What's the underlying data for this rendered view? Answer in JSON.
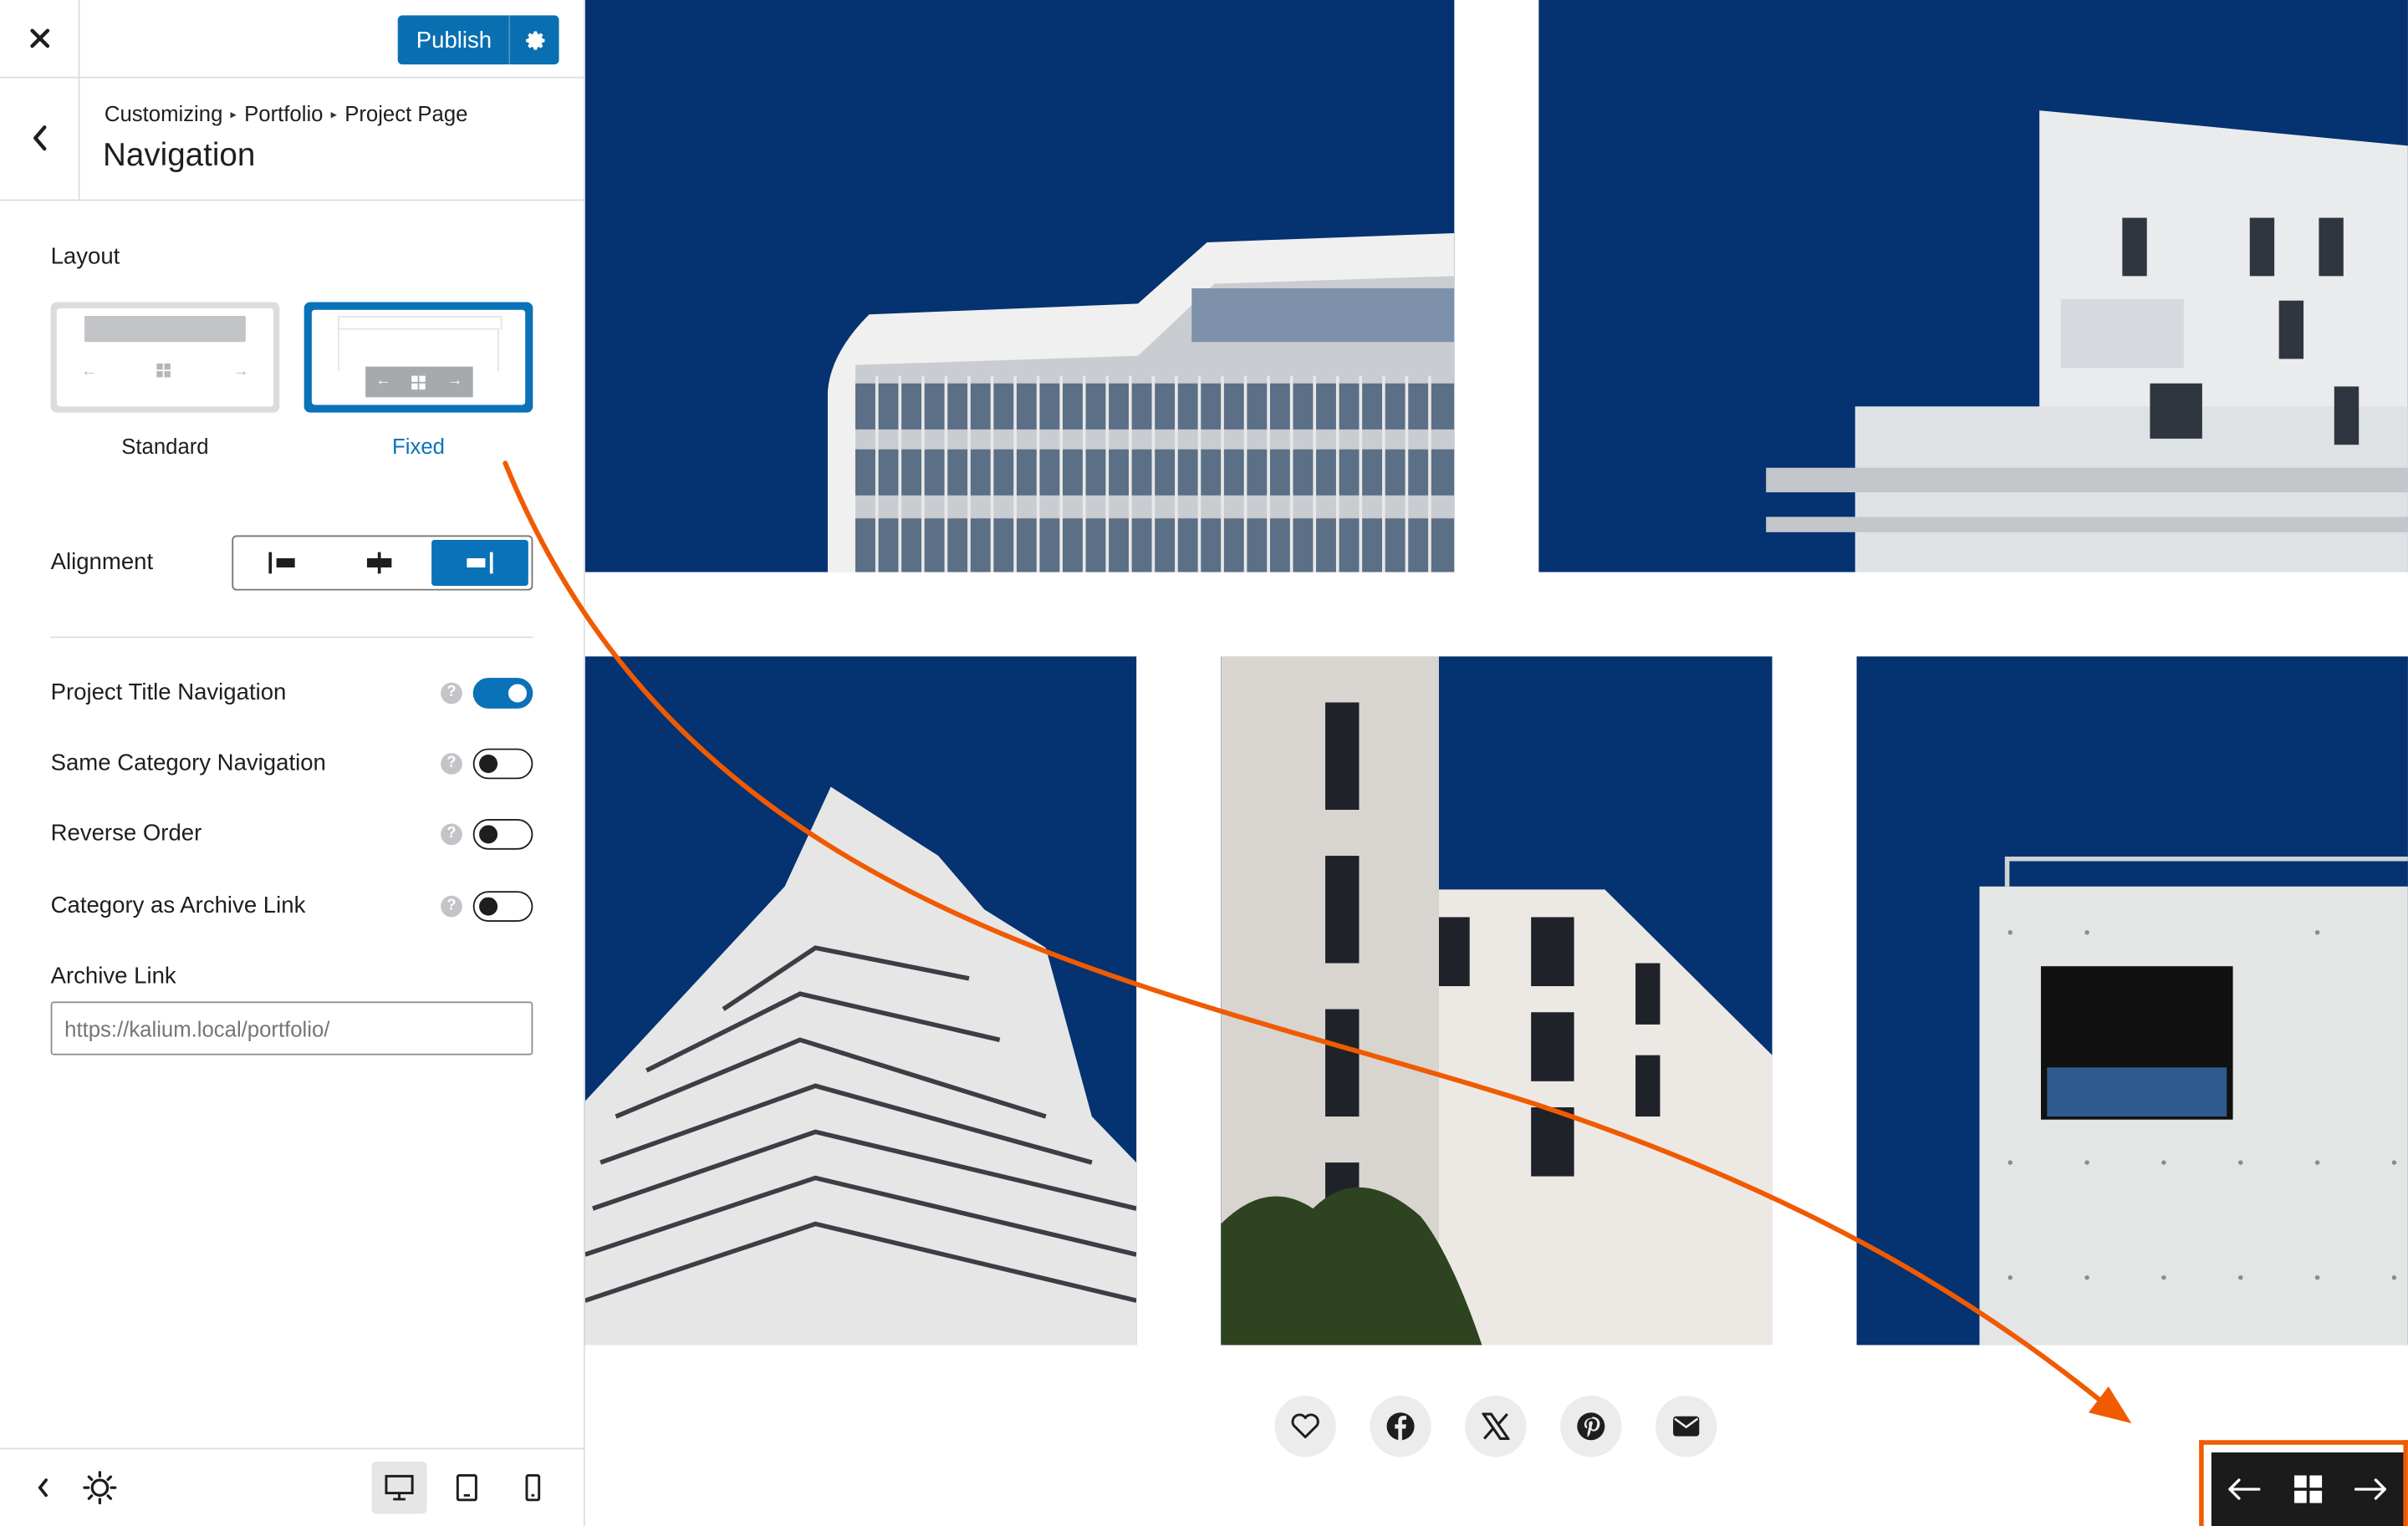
{
  "topbar": {
    "publish_label": "Publish"
  },
  "header": {
    "breadcrumb": [
      "Customizing",
      "Portfolio",
      "Project Page"
    ],
    "title": "Navigation"
  },
  "layout": {
    "label": "Layout",
    "options": [
      {
        "label": "Standard",
        "selected": false
      },
      {
        "label": "Fixed",
        "selected": true
      }
    ]
  },
  "alignment": {
    "label": "Alignment",
    "options": [
      "left",
      "center",
      "right"
    ],
    "selected": "right"
  },
  "toggles": [
    {
      "label": "Project Title Navigation",
      "on": true
    },
    {
      "label": "Same Category Navigation",
      "on": false
    },
    {
      "label": "Reverse Order",
      "on": false
    },
    {
      "label": "Category as Archive Link",
      "on": false
    }
  ],
  "archive_link": {
    "label": "Archive Link",
    "placeholder": "https://kalium.local/portfolio/"
  },
  "footer": {
    "devices": [
      "desktop",
      "tablet",
      "mobile"
    ],
    "active_device": "desktop"
  },
  "preview": {
    "share_icons": [
      "heart-icon",
      "facebook-icon",
      "x-icon",
      "pinterest-icon",
      "email-icon"
    ],
    "fixed_nav_icons": [
      "arrow-left-icon",
      "grid-icon",
      "arrow-right-icon"
    ]
  },
  "colors": {
    "accent": "#0a72b8",
    "sky": "#053270",
    "annotation": "#f05a00",
    "nav_bg": "#1b1b1b"
  }
}
